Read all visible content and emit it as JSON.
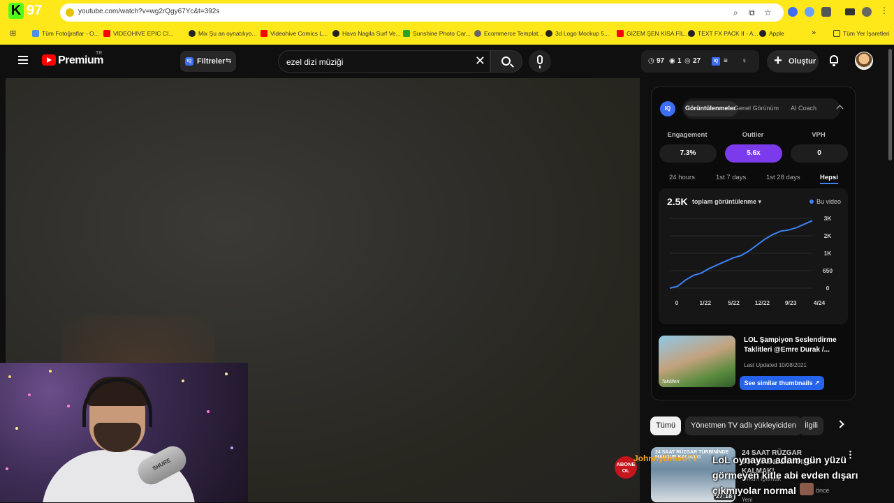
{
  "browser": {
    "url": "youtube.com/watch?v=wg2rQgy67Yc&t=392s",
    "kick_logo": "K",
    "kick_count": "97",
    "bookmarks": [
      {
        "label": "Tüm Fotoğraflar - O...",
        "color": "#4a90e2"
      },
      {
        "label": "VIDEOHIVE EPIC CI...",
        "color": "#ff0000"
      },
      {
        "label": "Mix Şu an oynatılıyo...",
        "color": "#222222"
      },
      {
        "label": "Videohive Comics L...",
        "color": "#ff0000"
      },
      {
        "label": "Hava Nagila Surf Ve...",
        "color": "#222222"
      },
      {
        "label": "Sunshine Photo Car...",
        "color": "#2aa32a"
      },
      {
        "label": "Ecommerce Templat...",
        "color": "#666666"
      },
      {
        "label": "3d Logo Mockup 5...",
        "color": "#222222"
      },
      {
        "label": "GIZEM ŞEN KISA FİL...",
        "color": "#222222"
      },
      {
        "label": "TEXT FX PACK II - A...",
        "color": "#ff0000"
      },
      {
        "label": "Apple",
        "color": "#222222"
      }
    ],
    "bookmarks_more": "»",
    "all_bookmarks": "Tüm Yer İşaretleri"
  },
  "header": {
    "brand": "Premium",
    "region": "TR",
    "filters_label": "Filtreler",
    "filters_badge": "IQ",
    "search_value": "ezel dizi müziği",
    "stats": {
      "views": "97",
      "first": "1",
      "second": "27"
    },
    "create_label": "Oluştur"
  },
  "iq_panel": {
    "logo": "IQ",
    "tabs": [
      "Görüntülenmeler",
      "Genel Görünüm",
      "AI Coach"
    ],
    "metrics": [
      {
        "label": "Engagement",
        "value": "7.3%"
      },
      {
        "label": "Outlier",
        "value": "5.6x"
      },
      {
        "label": "VPH",
        "value": "0"
      }
    ],
    "ranges": [
      "24 hours",
      "1st 7 days",
      "1st 28 days",
      "Hepsi"
    ],
    "total": "2.5K",
    "metric_select": "toplam görüntülenme ▾",
    "legend": "Bu video",
    "thumbnail_text": "Taklitleri",
    "video_title": "LOL Şampiyon Seslendirme Taklitleri @Emre Durak /...",
    "last_updated": "Last Updated 10/08/2021",
    "similar_button": "See similar thumbnails ↗"
  },
  "chart_data": {
    "type": "line",
    "x_ticks": [
      "0",
      "1/22",
      "5/22",
      "12/22",
      "9/23",
      "4/24"
    ],
    "y_ticks": [
      "3K",
      "2K",
      "1K",
      "650",
      "0"
    ],
    "series": [
      {
        "name": "Bu video",
        "color": "#3b82f6",
        "values": [
          0,
          80,
          350,
          550,
          650,
          850,
          1000,
          1150,
          1300,
          1400,
          1600,
          1850,
          2100,
          2300,
          2450,
          2500,
          2600,
          2750,
          2900
        ]
      }
    ],
    "grid": true
  },
  "chips": [
    "Tümü",
    "Yönetmen TV adlı yükleyiciden",
    "İlgili"
  ],
  "recommendation": {
    "thumb_caption": "24 SAAT RÜZGAR TÜRBİNİNDE MAHSUR KALMAK!",
    "duration": "27:18",
    "channel": "Orkun Işıtmak",
    "time": "önce",
    "badge": "Yeni"
  },
  "chat_overlay": {
    "subscribe_badge": "ABONE OL",
    "username": "JohnnyBravoTV",
    "message": "LoL oynayan adam gün yüzü görmeyen kitle abi evden dışarı çıkmıyolar normal"
  }
}
